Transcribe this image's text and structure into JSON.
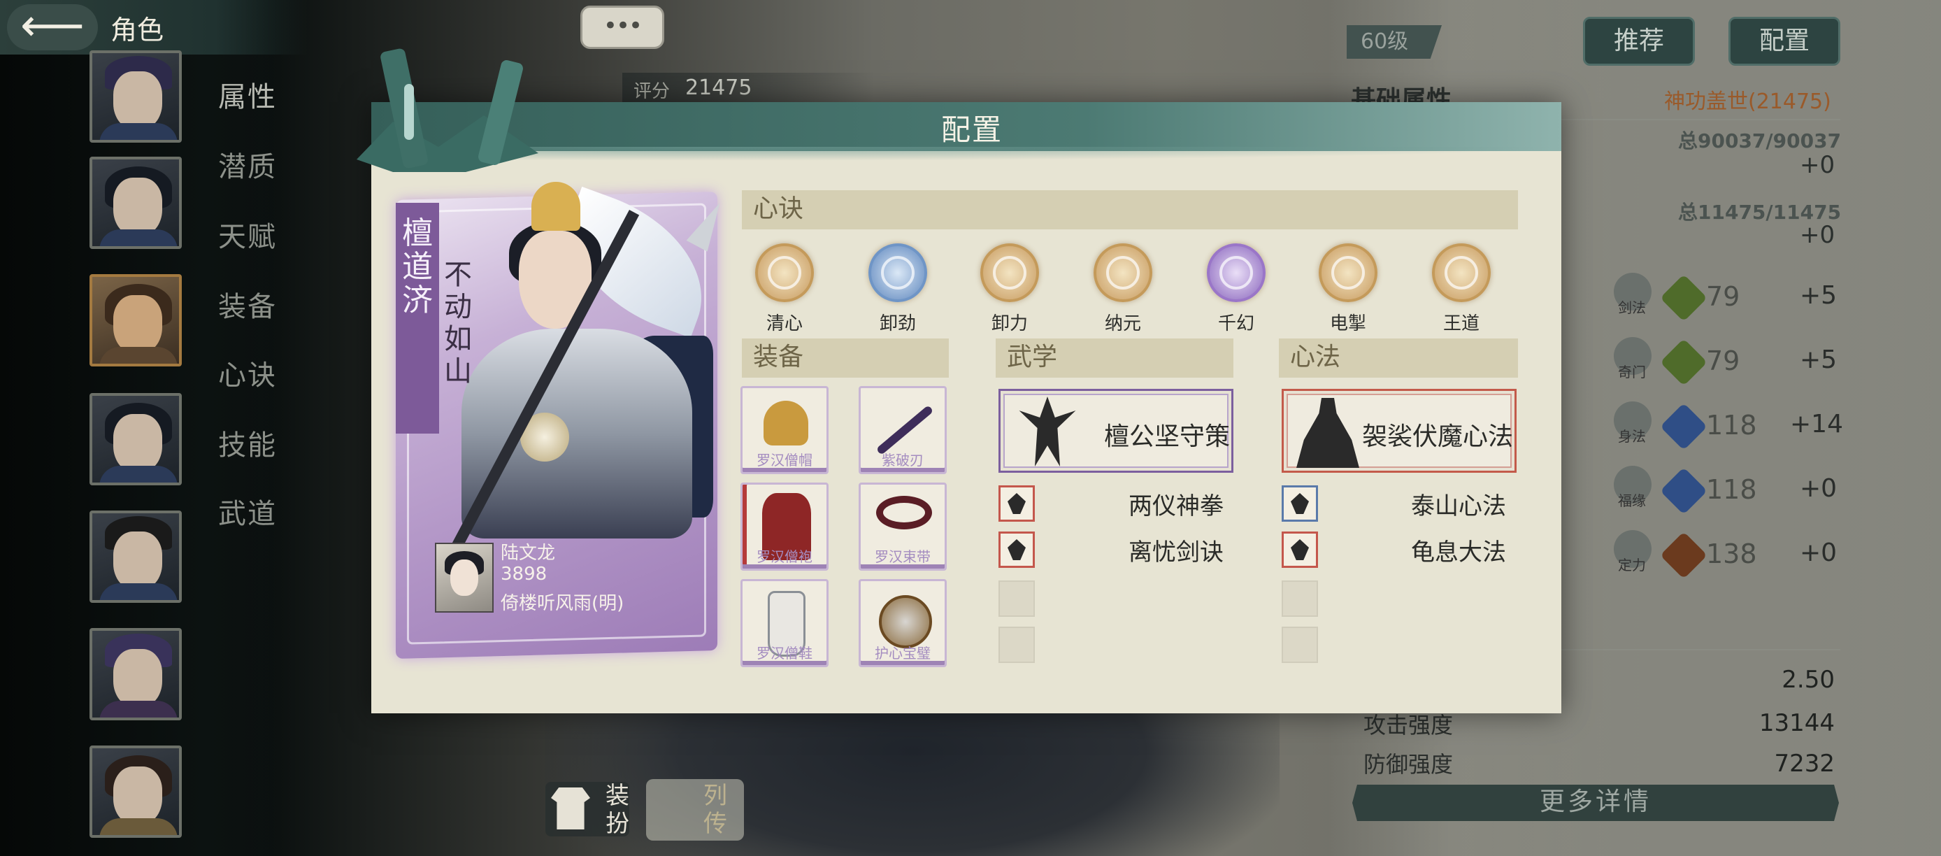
{
  "header": {
    "back_icon": "back-arrow-icon",
    "title": "角色"
  },
  "nav_tabs": [
    "属性",
    "潜质",
    "天赋",
    "装备",
    "心诀",
    "技能",
    "武道"
  ],
  "chat_bubble": "•••",
  "score": {
    "label": "评分",
    "value": "21475"
  },
  "right_panel": {
    "level": "60级",
    "buttons": {
      "recommend": "推荐",
      "config": "配置"
    },
    "section_title": "基础属性",
    "power": "神功盖世(21475)",
    "hp_total": "总90037/90037",
    "hp_plus": "+0",
    "mp_total": "总11475/11475",
    "mp_plus": "+0",
    "stats": [
      {
        "name": "剑法",
        "gem": "内",
        "value": "79",
        "plus": "+5"
      },
      {
        "name": "奇门",
        "gem": "内",
        "value": "79",
        "plus": "+5"
      },
      {
        "name": "身法",
        "gem": "乙",
        "value": "118",
        "plus": "+14"
      },
      {
        "name": "福缘",
        "gem": "乙",
        "value": "118",
        "plus": "+0"
      },
      {
        "name": "定力",
        "gem": "田",
        "value": "138",
        "plus": "+0"
      }
    ],
    "rows": [
      {
        "label": "",
        "value": "2.50"
      },
      {
        "label": "攻击强度",
        "value": "13144"
      },
      {
        "label": "防御强度",
        "value": "7232"
      }
    ],
    "more_details": "更多详情"
  },
  "bottom_buttons": {
    "dress": "装扮",
    "bio": "列传"
  },
  "modal": {
    "title": "配置",
    "hero": {
      "name": "檀道济",
      "epithet": "不动如山",
      "player_name": "陆文龙",
      "player_id": "3898",
      "player_server": "倚楼听风雨(明)"
    },
    "sections": {
      "xinjue": "心诀",
      "equipment": "装备",
      "martial": "武学",
      "mental": "心法"
    },
    "xinjue": [
      {
        "label": "清心",
        "icon": "lotus-icon",
        "color": "#d8b483"
      },
      {
        "label": "卸劲",
        "icon": "water-swirl-icon",
        "color": "#6f95c6"
      },
      {
        "label": "卸力",
        "icon": "flame-swirl-icon",
        "color": "#c99a5c"
      },
      {
        "label": "纳元",
        "icon": "flower-icon",
        "color": "#c99a5c"
      },
      {
        "label": "千幻",
        "icon": "star-swirl-icon",
        "color": "#9a76c8"
      },
      {
        "label": "电掣",
        "icon": "lightning-icon",
        "color": "#c99a5c"
      },
      {
        "label": "王道",
        "icon": "dragon-icon",
        "color": "#c99a5c"
      }
    ],
    "equipment": [
      {
        "label": "罗汉僧帽",
        "icon": "hat-icon"
      },
      {
        "label": "紫破刃",
        "icon": "blade-icon"
      },
      {
        "label": "罗汉僧袍",
        "icon": "robe-icon"
      },
      {
        "label": "罗汉束带",
        "icon": "beads-icon"
      },
      {
        "label": "罗汉僧鞋",
        "icon": "boots-icon"
      },
      {
        "label": "护心宝璧",
        "icon": "mirror-icon"
      }
    ],
    "martial": {
      "main": {
        "label": "檀公坚守策",
        "icon": "warrior-icon"
      },
      "subs": [
        {
          "label": "两仪神拳",
          "icon": "fist-icon"
        },
        {
          "label": "离忧剑诀",
          "icon": "sword-dancer-icon"
        }
      ]
    },
    "mental": {
      "main": {
        "label": "袈裟伏魔心法",
        "icon": "monk-icon"
      },
      "subs": [
        {
          "label": "泰山心法",
          "icon": "mountain-icon"
        },
        {
          "label": "龟息大法",
          "icon": "meditate-icon"
        }
      ]
    }
  }
}
